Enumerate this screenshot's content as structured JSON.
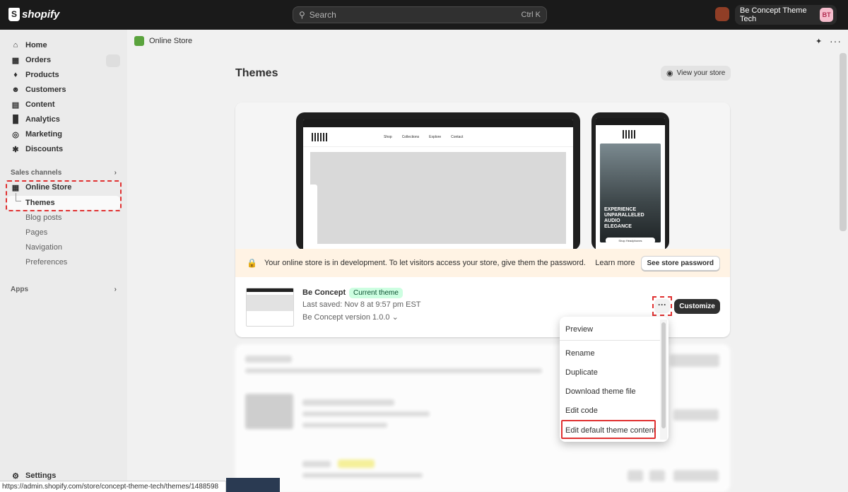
{
  "topbar": {
    "logo": "shopify",
    "search_placeholder": "Search",
    "search_shortcut": "Ctrl K",
    "store_name": "Be Concept Theme Tech",
    "avatar_initials": "BT"
  },
  "sidebar": {
    "main_items": [
      {
        "label": "Home",
        "icon": "home-icon"
      },
      {
        "label": "Orders",
        "icon": "inbox-icon"
      },
      {
        "label": "Products",
        "icon": "tag-icon"
      },
      {
        "label": "Customers",
        "icon": "person-icon"
      },
      {
        "label": "Content",
        "icon": "document-icon"
      },
      {
        "label": "Analytics",
        "icon": "chart-bars-icon"
      },
      {
        "label": "Marketing",
        "icon": "target-icon"
      },
      {
        "label": "Discounts",
        "icon": "discount-icon"
      }
    ],
    "sales_channels_label": "Sales channels",
    "online_store_label": "Online Store",
    "sub_items": [
      "Themes",
      "Blog posts",
      "Pages",
      "Navigation",
      "Preferences"
    ],
    "apps_label": "Apps",
    "settings_label": "Settings"
  },
  "main": {
    "breadcrumb": "Online Store",
    "page_title": "Themes",
    "view_store_label": "View your store"
  },
  "preview": {
    "desktop_menu": [
      "Shop",
      "Collections",
      "Explore",
      "Contact"
    ],
    "mobile_headline": [
      "EXPERIENCE",
      "UNPARALLELED",
      "AUDIO",
      "ELEGANCE"
    ],
    "mobile_button": "Shop Headphones"
  },
  "dev_banner": {
    "message": "Your online store is in development. To let visitors access your store, give them the password.",
    "learn_more": "Learn more",
    "password_button": "See store password"
  },
  "theme": {
    "name": "Be Concept",
    "badge": "Current theme",
    "last_saved": "Last saved: Nov 8 at 9:57 pm EST",
    "version": "Be Concept version 1.0.0",
    "customize_label": "Customize"
  },
  "menu": {
    "items": [
      "Preview",
      "Rename",
      "Duplicate",
      "Download theme file",
      "Edit code",
      "Edit default theme content"
    ]
  },
  "status_url": "https://admin.shopify.com/store/concept-theme-tech/themes/1488598",
  "colors": {
    "topbar": "#1a1a1a",
    "highlight": "#e03131",
    "badge_bg": "#cdfee1",
    "banner_bg": "#fff3e4"
  }
}
